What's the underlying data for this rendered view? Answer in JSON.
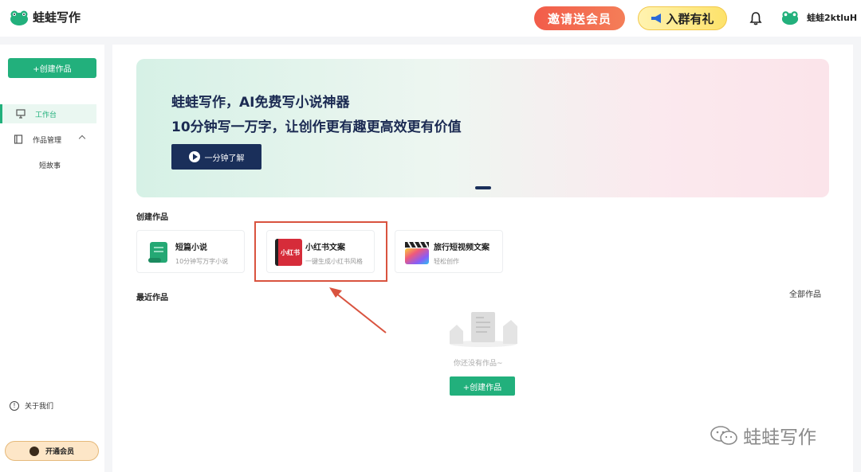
{
  "app": {
    "name": "蛙蛙写作"
  },
  "header": {
    "invite_label": "邀请送会员",
    "group_label": "入群有礼",
    "username": "蛙蛙2ktluH"
  },
  "sidebar": {
    "create_label": "+创建作品",
    "items": [
      {
        "label": "工作台",
        "icon": "monitor-icon",
        "active": true
      },
      {
        "label": "作品管理",
        "icon": "book-icon",
        "active": false
      }
    ],
    "sub_item": "短故事",
    "about_label": "关于我们",
    "vip_label": "开通会员"
  },
  "banner": {
    "title": "蛙蛙写作，AI免费写小说神器",
    "subtitle": "10分钟写一万字，让创作更有趣更高效更有价值",
    "button_label": "一分钟了解"
  },
  "create_section": {
    "title": "创建作品",
    "cards": [
      {
        "title": "短篇小说",
        "desc": "10分钟写万字小说",
        "icon": "scroll-icon"
      },
      {
        "title": "小红书文案",
        "desc": "一键生成小红书风格",
        "icon": "xiaohongshu-icon",
        "thumb_text": "小红书"
      },
      {
        "title": "旅行短视频文案",
        "desc": "轻松创作",
        "icon": "clapperboard-icon"
      }
    ]
  },
  "recent": {
    "title": "最近作品",
    "all_label": "全部作品",
    "empty_text": "你还没有作品~",
    "create_label": "+创建作品"
  },
  "watermark": {
    "text": "蛙蛙写作"
  },
  "colors": {
    "accent": "#22b07c",
    "navy": "#1a2f5a",
    "highlight": "#d9533f"
  }
}
